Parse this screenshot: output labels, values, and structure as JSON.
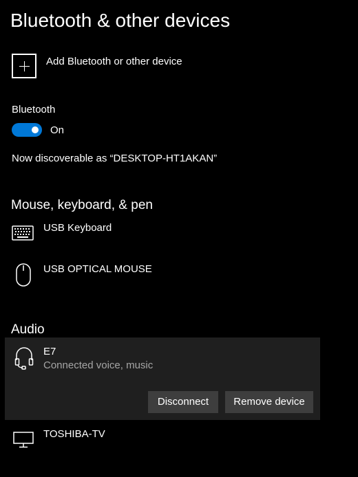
{
  "page": {
    "title": "Bluetooth & other devices"
  },
  "add_device": {
    "label": "Add Bluetooth or other device",
    "icon": "plus-icon"
  },
  "bluetooth": {
    "label": "Bluetooth",
    "toggle_state": "On",
    "discoverable_text": "Now discoverable as “DESKTOP-HT1AKAN”",
    "accent_color": "#0078d7"
  },
  "sections": {
    "mouse_keyboard_pen": {
      "heading": "Mouse, keyboard, & pen",
      "devices": [
        {
          "name": "USB Keyboard",
          "icon": "keyboard-icon"
        },
        {
          "name": "USB OPTICAL MOUSE",
          "icon": "mouse-icon"
        }
      ]
    },
    "audio": {
      "heading": "Audio",
      "devices": [
        {
          "name": "E7",
          "status": "Connected voice, music",
          "icon": "headset-icon",
          "actions": {
            "disconnect": "Disconnect",
            "remove": "Remove device"
          }
        }
      ]
    },
    "other": {
      "devices": [
        {
          "name": "TOSHIBA-TV",
          "icon": "monitor-icon"
        }
      ]
    }
  },
  "colors": {
    "background": "#000000",
    "text": "#ffffff",
    "secondary_text": "#a6a6a6",
    "selected_panel": "#1f1f1f",
    "button": "#3e3e3e"
  }
}
